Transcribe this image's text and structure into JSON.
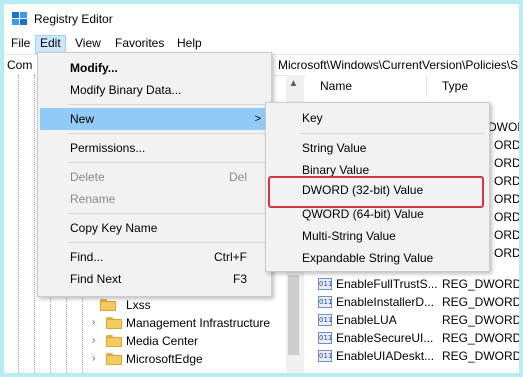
{
  "window": {
    "title": "Registry Editor",
    "icon": "registry-app-icon"
  },
  "menubar": {
    "items": [
      "File",
      "Edit",
      "View",
      "Favorites",
      "Help"
    ],
    "active": "Edit"
  },
  "address": {
    "left": "Com",
    "right": "Microsoft\\Windows\\CurrentVersion\\Policies\\S"
  },
  "tree": {
    "items": [
      "Lxss",
      "Management Infrastructure",
      "Media Center",
      "MicrosoftEdge"
    ]
  },
  "list": {
    "headers": {
      "name": "Name",
      "type": "Type"
    },
    "partial_types": [
      "DWORD",
      "ORD",
      "ORD",
      "ORD",
      "ORD",
      "ORD",
      "ORD",
      "ORD"
    ],
    "rows": [
      {
        "name": "EnableFullTrustS...",
        "type": "REG_DWORD"
      },
      {
        "name": "EnableInstallerD...",
        "type": "REG_DWORD"
      },
      {
        "name": "EnableLUA",
        "type": "REG_DWORD"
      },
      {
        "name": "EnableSecureUI...",
        "type": "REG_DWORD"
      },
      {
        "name": "EnableUIADeskt...",
        "type": "REG_DWORD"
      }
    ],
    "icon_text": "011"
  },
  "edit_menu": {
    "items": [
      {
        "label": "Modify...",
        "bold": true
      },
      {
        "label": "Modify Binary Data..."
      },
      {
        "label": "New",
        "submenu": true,
        "highlighted": true
      },
      {
        "label": "Permissions..."
      },
      {
        "label": "Delete",
        "shortcut": "Del",
        "disabled": true
      },
      {
        "label": "Rename",
        "disabled": true
      },
      {
        "label": "Copy Key Name"
      },
      {
        "label": "Find...",
        "shortcut": "Ctrl+F"
      },
      {
        "label": "Find Next",
        "shortcut": "F3"
      }
    ],
    "arrow": ">"
  },
  "new_submenu": {
    "items": [
      "Key",
      "String Value",
      "Binary Value",
      "DWORD (32-bit) Value",
      "QWORD (64-bit) Value",
      "Multi-String Value",
      "Expandable String Value"
    ],
    "highlighted": "DWORD (32-bit) Value"
  },
  "colors": {
    "menu_highlight": "#91c9f7",
    "callout": "#d0393f",
    "frame": "#b7ecf2"
  }
}
